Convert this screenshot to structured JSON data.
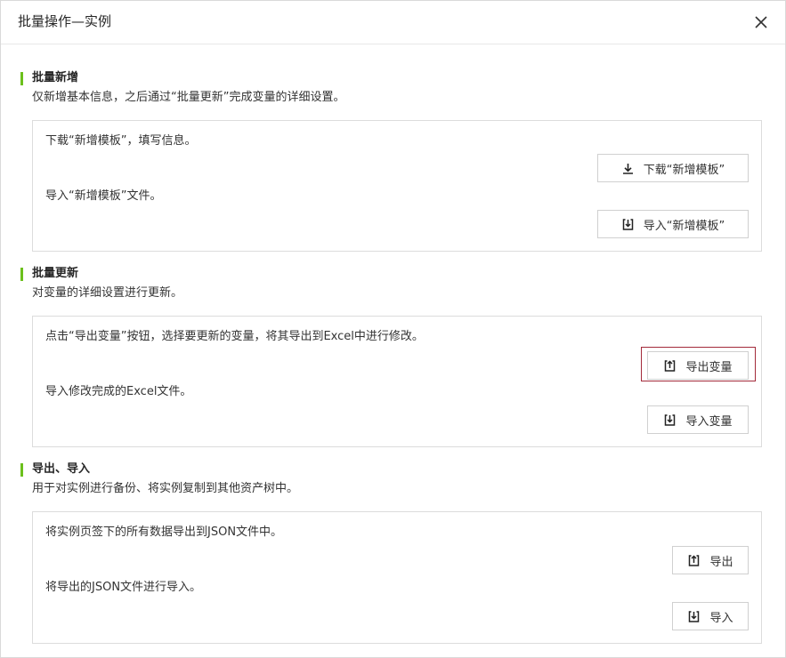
{
  "dialog": {
    "title": "批量操作—实例",
    "close_icon": "close-icon"
  },
  "sections": [
    {
      "title": "批量新增",
      "description": "仅新增基本信息，之后通过“批量更新”完成变量的详细设置。",
      "steps": [
        {
          "text": "下载“新增模板”，填写信息。",
          "button_label": "下载“新增模板”",
          "icon": "download-icon"
        },
        {
          "text": "导入“新增模板”文件。",
          "button_label": "导入“新增模板”",
          "icon": "import-icon"
        }
      ]
    },
    {
      "title": "批量更新",
      "description": "对变量的详细设置进行更新。",
      "steps": [
        {
          "text": "点击“导出变量”按钮，选择要更新的变量，将其导出到Excel中进行修改。",
          "button_label": "导出变量",
          "icon": "export-icon"
        },
        {
          "text": "导入修改完成的Excel文件。",
          "button_label": "导入变量",
          "icon": "import-icon"
        }
      ]
    },
    {
      "title": "导出、导入",
      "description": "用于对实例进行备份、将实例复制到其他资产树中。",
      "steps": [
        {
          "text": "将实例页签下的所有数据导出到JSON文件中。",
          "button_label": "导出",
          "icon": "export-icon"
        },
        {
          "text": "将导出的JSON文件进行导入。",
          "button_label": "导入",
          "icon": "import-icon"
        }
      ]
    }
  ],
  "colors": {
    "accent_bar": "#6cc01c",
    "focus_ring": "#a32a3a"
  }
}
